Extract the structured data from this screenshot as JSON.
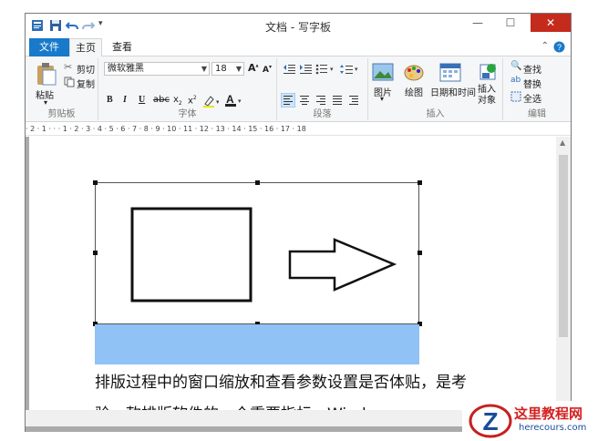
{
  "window": {
    "title": "文档 - 写字板",
    "controls": {
      "minimize": "—",
      "maximize": "☐",
      "close": "✕"
    }
  },
  "ribbon_tabs": [
    "文件",
    "主页",
    "查看"
  ],
  "clipboard": {
    "paste_label": "粘贴",
    "cut_label": "剪切",
    "copy_label": "复制",
    "group_label": "剪贴板"
  },
  "font": {
    "family": "微软雅黑",
    "size": "18",
    "group_label": "字体"
  },
  "paragraph": {
    "group_label": "段落"
  },
  "insert": {
    "picture_label": "图片",
    "paint_label": "绘图",
    "datetime_label": "日期和时间",
    "object_label": "插入对象",
    "group_label": "插入"
  },
  "editing": {
    "find_label": "查找",
    "replace_label": "替换",
    "selectall_label": "全选",
    "group_label": "编辑"
  },
  "ruler": "· 2 · 1 · · · 1 · 2 · 3 · 4 · 5 · 6 · 7 · 8 · 9 · 10 · 11 · 12 · 13 · 14 · 15 · 16 · 17 · 18",
  "document": {
    "line1": "排版过程中的窗口缩放和查看参数设置是否体贴，是考",
    "line2": "验一款排版软件的一个重要指标。Windows"
  },
  "watermark": {
    "title": "这里教程网",
    "url": "herecours.com"
  },
  "colors": {
    "accent": "#1979ca",
    "close": "#c42b1c",
    "selection_band": "#90c2f6"
  }
}
